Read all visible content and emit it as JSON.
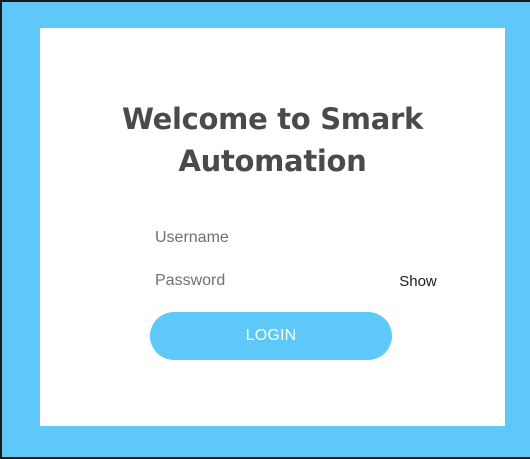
{
  "login": {
    "title": "Welcome to Smark Automation",
    "username_placeholder": "Username",
    "username_value": "",
    "password_placeholder": "Password",
    "password_value": "",
    "show_label": "Show",
    "login_label": "LOGIN"
  },
  "colors": {
    "background": "#5ec8f8",
    "card": "#ffffff",
    "accent": "#5ec8f8",
    "title_text": "#4a4a4a"
  }
}
